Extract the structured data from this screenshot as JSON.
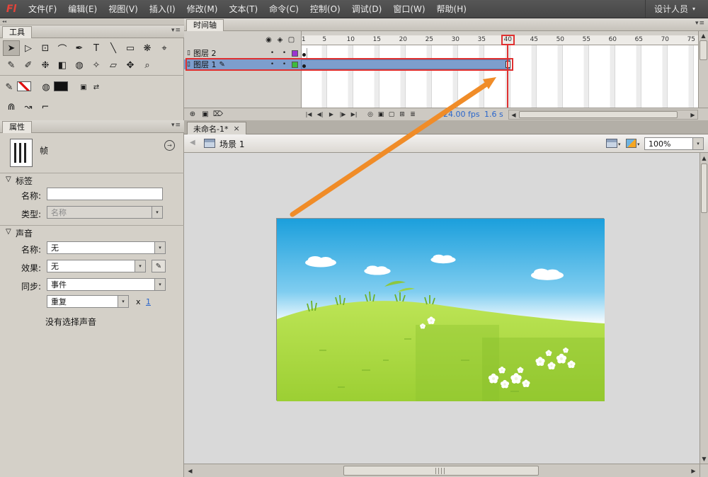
{
  "menu_bar": {
    "logo": "Fl",
    "items": [
      "文件(F)",
      "编辑(E)",
      "视图(V)",
      "插入(I)",
      "修改(M)",
      "文本(T)",
      "命令(C)",
      "控制(O)",
      "调试(D)",
      "窗口(W)",
      "帮助(H)"
    ],
    "workspace": "设计人员"
  },
  "icons": {
    "collapse": "◂◂",
    "panel_menu": "▾≡",
    "selection_tool": "➤",
    "subselection_tool": "▷",
    "free_transform_tool": "⊡",
    "lasso_tool": "⌒",
    "pen_tool": "✒",
    "text_tool": "T",
    "line_tool": "╲",
    "rectangle_tool": "▭",
    "deco_tool": "❋",
    "bone_tool": "⌖",
    "pencil_tool": "✎",
    "brush_tool": "✐",
    "spray_brush_tool": "❉",
    "ink_bottle_tool": "◧",
    "paint_bucket_tool": "◍",
    "eyedropper_tool": "✧",
    "eraser_tool": "▱",
    "hand_tool": "✥",
    "zoom_tool": "⌕",
    "default_colors": "▣",
    "swap_colors": "⇄",
    "snap": "⋒",
    "smooth": "↝",
    "straighten": "⌐",
    "help_arrow": "→",
    "eye": "◉",
    "lock": "◈",
    "outline": "▢",
    "page": "▯",
    "pencil_edit": "✎",
    "new_layer": "⊕",
    "new_folder": "▣",
    "delete_layer": "⌦",
    "onion_center": "◎",
    "onion_skin": "▣",
    "onion_outline": "▢",
    "edit_multi_frames": "⊞",
    "modify_markers": "≣",
    "back": "◀",
    "caret": "▾",
    "dot": "•",
    "scroll_left": "◀",
    "scroll_right": "▶",
    "scroll_up": "▲",
    "scroll_down": "▼"
  },
  "section_marker": "▽",
  "panels": {
    "tools": {
      "title": "工具"
    },
    "properties": {
      "title": "属性",
      "object_type": "帧",
      "label_section": {
        "title": "标签",
        "name_label": "名称:",
        "name_value": "",
        "type_label": "类型:",
        "type_value": "名称"
      },
      "sound_section": {
        "title": "声音",
        "name_label": "名称:",
        "name_value": "无",
        "effect_label": "效果:",
        "effect_value": "无",
        "sync_label": "同步:",
        "sync_value": "事件",
        "repeat_value": "重复",
        "times_label": "x",
        "times_value": "1",
        "status": "没有选择声音"
      }
    },
    "timeline": {
      "title": "时间轴",
      "ruler": [
        "1",
        "5",
        "10",
        "15",
        "20",
        "25",
        "30",
        "35",
        "40",
        "45",
        "50",
        "55",
        "60",
        "65",
        "70",
        "75"
      ],
      "current_frame": "40",
      "layers": [
        {
          "name": "图层 2"
        },
        {
          "name": "图层 1"
        }
      ],
      "playback": [
        "|◀",
        "◀|",
        "▶",
        "|▶",
        "▶|"
      ],
      "fps": "24.00 fps",
      "time": "1.6 s"
    }
  },
  "document": {
    "tab": "未命名-1*",
    "close": "×",
    "scene": "场景 1",
    "zoom": "100%"
  },
  "colors": {
    "arrow_orange": "#f08c28",
    "playhead_red": "#e03030",
    "selection_blue": "#7d9ecd",
    "layer1_swatch": "#3dbb3d",
    "layer2_swatch": "#9a35d0",
    "sky_blue": "#1b9fdc",
    "grass_green": "#a8d83f"
  }
}
